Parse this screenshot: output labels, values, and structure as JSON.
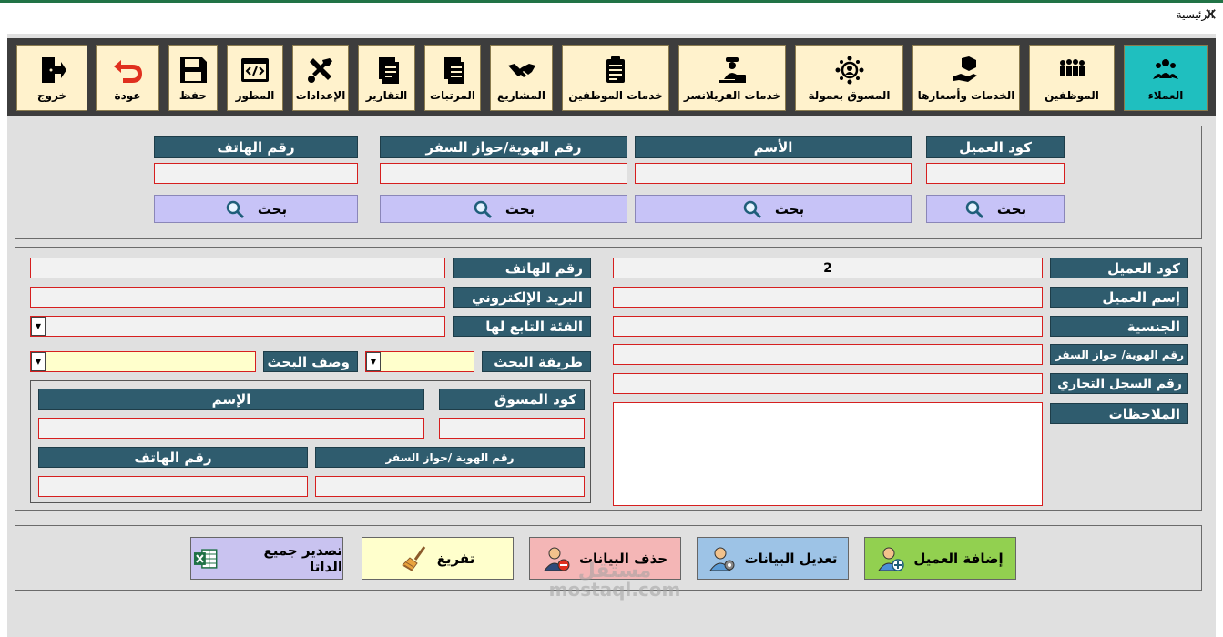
{
  "window": {
    "title": "الرئيسية",
    "close_glyph": "✕"
  },
  "toolbar": {
    "items": [
      {
        "label": "العملاء",
        "icon": "customers-icon",
        "active": true
      },
      {
        "label": "الموظفين",
        "icon": "employees-icon"
      },
      {
        "label": "الخدمات وأسعارها",
        "icon": "services-prices-icon"
      },
      {
        "label": "المسوق بعمولة",
        "icon": "affiliate-marketer-icon"
      },
      {
        "label": "خدمات الفريلانسر",
        "icon": "freelancer-icon"
      },
      {
        "label": "خدمات الموظفين",
        "icon": "clipboard-icon"
      },
      {
        "label": "المشاريع",
        "icon": "handshake-icon"
      },
      {
        "label": "المرتبات",
        "icon": "document-icon"
      },
      {
        "label": "التقارير",
        "icon": "report-icon"
      },
      {
        "label": "الإعدادات",
        "icon": "tools-icon"
      },
      {
        "label": "المطور",
        "icon": "code-icon"
      },
      {
        "label": "حفظ",
        "icon": "save-icon"
      },
      {
        "label": "عودة",
        "icon": "back-arrow-icon"
      },
      {
        "label": "خروج",
        "icon": "exit-icon"
      }
    ]
  },
  "search": {
    "code_label": "كود العميل",
    "name_label": "الأسم",
    "id_label": "رقم الهوية/حواز السفر",
    "phone_label": "رقم الهاتف",
    "button_label": "بحث",
    "code_value": "",
    "name_value": "",
    "id_value": "",
    "phone_value": ""
  },
  "details": {
    "code_label": "كود العميل",
    "code_value": "2",
    "name_label": "إسم العميل",
    "nationality_label": "الجنسية",
    "id_label": "رقم الهوية/ حواز السفر",
    "cr_label": "رقم السجل التجاري",
    "notes_label": "الملاحظات",
    "phone_label": "رقم الهاتف",
    "email_label": "البريد الإلكتروني",
    "category_label": "الفئة التابع لها",
    "search_method_label": "طريقة البحث",
    "search_desc_label": "وصف البحث"
  },
  "marketer": {
    "code_label": "كود المسوق",
    "name_label": "الإسم",
    "id_label": "رقم الهوية /حواز السفر",
    "phone_label": "رقم الهاتف"
  },
  "actions": {
    "add_label": "إضافة العميل",
    "edit_label": "تعديل البيانات",
    "delete_label": "حذف البيانات",
    "clear_label": "تفريغ",
    "export_label": "تصدير جميع الداتا"
  },
  "watermark": {
    "line1": "مستقل",
    "line2": "mostaql.com"
  },
  "colors": {
    "toolbar_bg": "#3d3d3d",
    "toolbar_button": "#fff2cc",
    "toolbar_active": "#1fbfbf",
    "label_bg": "#2f5c6e",
    "input_border": "#d61f1f",
    "search_button": "#c7c3f7",
    "add_button": "#92d050",
    "edit_button": "#9dc3e6",
    "delete_button": "#f4b6b6",
    "clear_button": "#ffffcc",
    "export_button": "#c9c3f0"
  }
}
